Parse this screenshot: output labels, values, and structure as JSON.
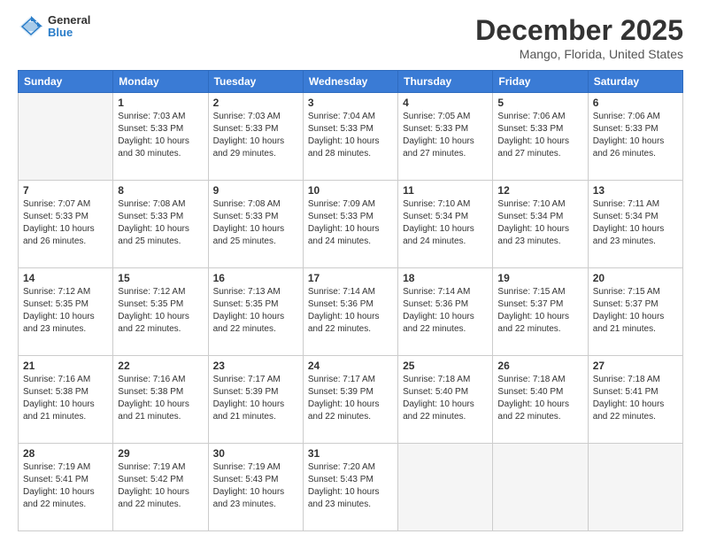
{
  "logo": {
    "general": "General",
    "blue": "Blue"
  },
  "title": "December 2025",
  "subtitle": "Mango, Florida, United States",
  "days_of_week": [
    "Sunday",
    "Monday",
    "Tuesday",
    "Wednesday",
    "Thursday",
    "Friday",
    "Saturday"
  ],
  "weeks": [
    [
      {
        "day": "",
        "info": ""
      },
      {
        "day": "1",
        "info": "Sunrise: 7:03 AM\nSunset: 5:33 PM\nDaylight: 10 hours\nand 30 minutes."
      },
      {
        "day": "2",
        "info": "Sunrise: 7:03 AM\nSunset: 5:33 PM\nDaylight: 10 hours\nand 29 minutes."
      },
      {
        "day": "3",
        "info": "Sunrise: 7:04 AM\nSunset: 5:33 PM\nDaylight: 10 hours\nand 28 minutes."
      },
      {
        "day": "4",
        "info": "Sunrise: 7:05 AM\nSunset: 5:33 PM\nDaylight: 10 hours\nand 27 minutes."
      },
      {
        "day": "5",
        "info": "Sunrise: 7:06 AM\nSunset: 5:33 PM\nDaylight: 10 hours\nand 27 minutes."
      },
      {
        "day": "6",
        "info": "Sunrise: 7:06 AM\nSunset: 5:33 PM\nDaylight: 10 hours\nand 26 minutes."
      }
    ],
    [
      {
        "day": "7",
        "info": "Sunrise: 7:07 AM\nSunset: 5:33 PM\nDaylight: 10 hours\nand 26 minutes."
      },
      {
        "day": "8",
        "info": "Sunrise: 7:08 AM\nSunset: 5:33 PM\nDaylight: 10 hours\nand 25 minutes."
      },
      {
        "day": "9",
        "info": "Sunrise: 7:08 AM\nSunset: 5:33 PM\nDaylight: 10 hours\nand 25 minutes."
      },
      {
        "day": "10",
        "info": "Sunrise: 7:09 AM\nSunset: 5:33 PM\nDaylight: 10 hours\nand 24 minutes."
      },
      {
        "day": "11",
        "info": "Sunrise: 7:10 AM\nSunset: 5:34 PM\nDaylight: 10 hours\nand 24 minutes."
      },
      {
        "day": "12",
        "info": "Sunrise: 7:10 AM\nSunset: 5:34 PM\nDaylight: 10 hours\nand 23 minutes."
      },
      {
        "day": "13",
        "info": "Sunrise: 7:11 AM\nSunset: 5:34 PM\nDaylight: 10 hours\nand 23 minutes."
      }
    ],
    [
      {
        "day": "14",
        "info": "Sunrise: 7:12 AM\nSunset: 5:35 PM\nDaylight: 10 hours\nand 23 minutes."
      },
      {
        "day": "15",
        "info": "Sunrise: 7:12 AM\nSunset: 5:35 PM\nDaylight: 10 hours\nand 22 minutes."
      },
      {
        "day": "16",
        "info": "Sunrise: 7:13 AM\nSunset: 5:35 PM\nDaylight: 10 hours\nand 22 minutes."
      },
      {
        "day": "17",
        "info": "Sunrise: 7:14 AM\nSunset: 5:36 PM\nDaylight: 10 hours\nand 22 minutes."
      },
      {
        "day": "18",
        "info": "Sunrise: 7:14 AM\nSunset: 5:36 PM\nDaylight: 10 hours\nand 22 minutes."
      },
      {
        "day": "19",
        "info": "Sunrise: 7:15 AM\nSunset: 5:37 PM\nDaylight: 10 hours\nand 22 minutes."
      },
      {
        "day": "20",
        "info": "Sunrise: 7:15 AM\nSunset: 5:37 PM\nDaylight: 10 hours\nand 21 minutes."
      }
    ],
    [
      {
        "day": "21",
        "info": "Sunrise: 7:16 AM\nSunset: 5:38 PM\nDaylight: 10 hours\nand 21 minutes."
      },
      {
        "day": "22",
        "info": "Sunrise: 7:16 AM\nSunset: 5:38 PM\nDaylight: 10 hours\nand 21 minutes."
      },
      {
        "day": "23",
        "info": "Sunrise: 7:17 AM\nSunset: 5:39 PM\nDaylight: 10 hours\nand 21 minutes."
      },
      {
        "day": "24",
        "info": "Sunrise: 7:17 AM\nSunset: 5:39 PM\nDaylight: 10 hours\nand 22 minutes."
      },
      {
        "day": "25",
        "info": "Sunrise: 7:18 AM\nSunset: 5:40 PM\nDaylight: 10 hours\nand 22 minutes."
      },
      {
        "day": "26",
        "info": "Sunrise: 7:18 AM\nSunset: 5:40 PM\nDaylight: 10 hours\nand 22 minutes."
      },
      {
        "day": "27",
        "info": "Sunrise: 7:18 AM\nSunset: 5:41 PM\nDaylight: 10 hours\nand 22 minutes."
      }
    ],
    [
      {
        "day": "28",
        "info": "Sunrise: 7:19 AM\nSunset: 5:41 PM\nDaylight: 10 hours\nand 22 minutes."
      },
      {
        "day": "29",
        "info": "Sunrise: 7:19 AM\nSunset: 5:42 PM\nDaylight: 10 hours\nand 22 minutes."
      },
      {
        "day": "30",
        "info": "Sunrise: 7:19 AM\nSunset: 5:43 PM\nDaylight: 10 hours\nand 23 minutes."
      },
      {
        "day": "31",
        "info": "Sunrise: 7:20 AM\nSunset: 5:43 PM\nDaylight: 10 hours\nand 23 minutes."
      },
      {
        "day": "",
        "info": ""
      },
      {
        "day": "",
        "info": ""
      },
      {
        "day": "",
        "info": ""
      }
    ]
  ]
}
